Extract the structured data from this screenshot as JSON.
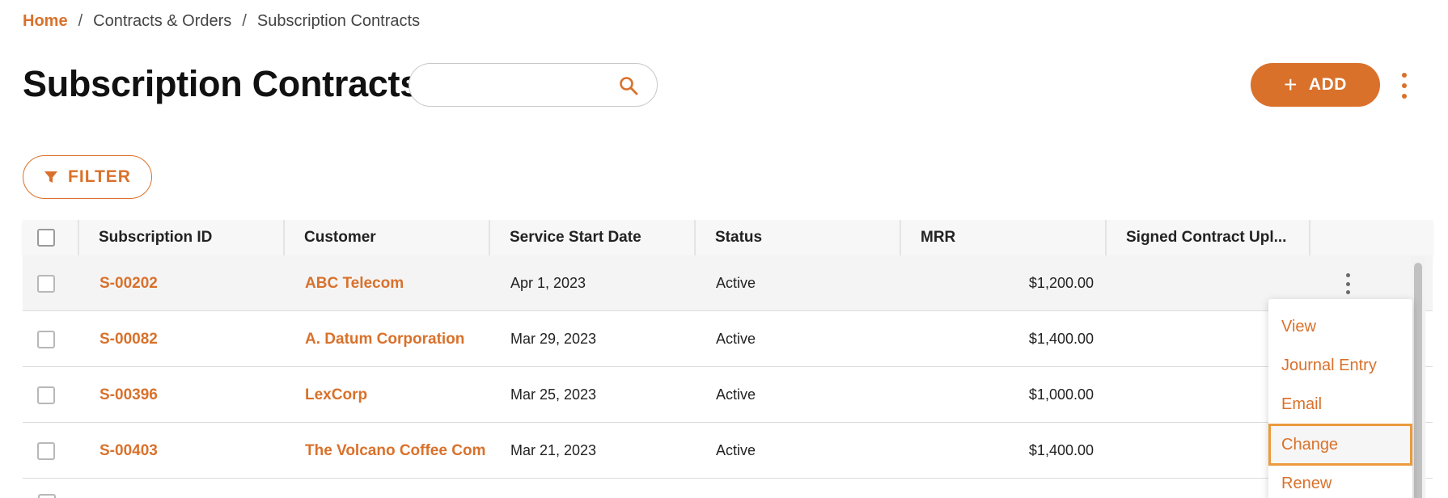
{
  "breadcrumb": {
    "home": "Home",
    "separator": "/",
    "level1": "Contracts & Orders",
    "current": "Subscription Contracts"
  },
  "page_title": "Subscription Contracts",
  "search": {
    "value": "",
    "placeholder": ""
  },
  "actions": {
    "add_label": "ADD",
    "add_icon": "+",
    "filter_label": "FILTER"
  },
  "colors": {
    "accent": "#d9712b",
    "focus_ring": "#eb9a3e",
    "header_bg": "#f7f7f7"
  },
  "table": {
    "columns": [
      "Subscription ID",
      "Customer",
      "Service Start Date",
      "Status",
      "MRR",
      "Signed Contract Upl..."
    ],
    "rows": [
      {
        "id": "S-00202",
        "customer": "ABC Telecom",
        "start_date": "Apr 1, 2023",
        "status": "Active",
        "mrr": "$1,200.00"
      },
      {
        "id": "S-00082",
        "customer": "A. Datum Corporation",
        "start_date": "Mar 29, 2023",
        "status": "Active",
        "mrr": "$1,400.00"
      },
      {
        "id": "S-00396",
        "customer": "LexCorp",
        "start_date": "Mar 25, 2023",
        "status": "Active",
        "mrr": "$1,000.00"
      },
      {
        "id": "S-00403",
        "customer": "The Volcano Coffee Com",
        "start_date": "Mar 21, 2023",
        "status": "Active",
        "mrr": "$1,400.00"
      }
    ]
  },
  "row_menu": {
    "items": [
      "View",
      "Journal Entry",
      "Email",
      "Change",
      "Renew"
    ],
    "focused": "Change"
  }
}
